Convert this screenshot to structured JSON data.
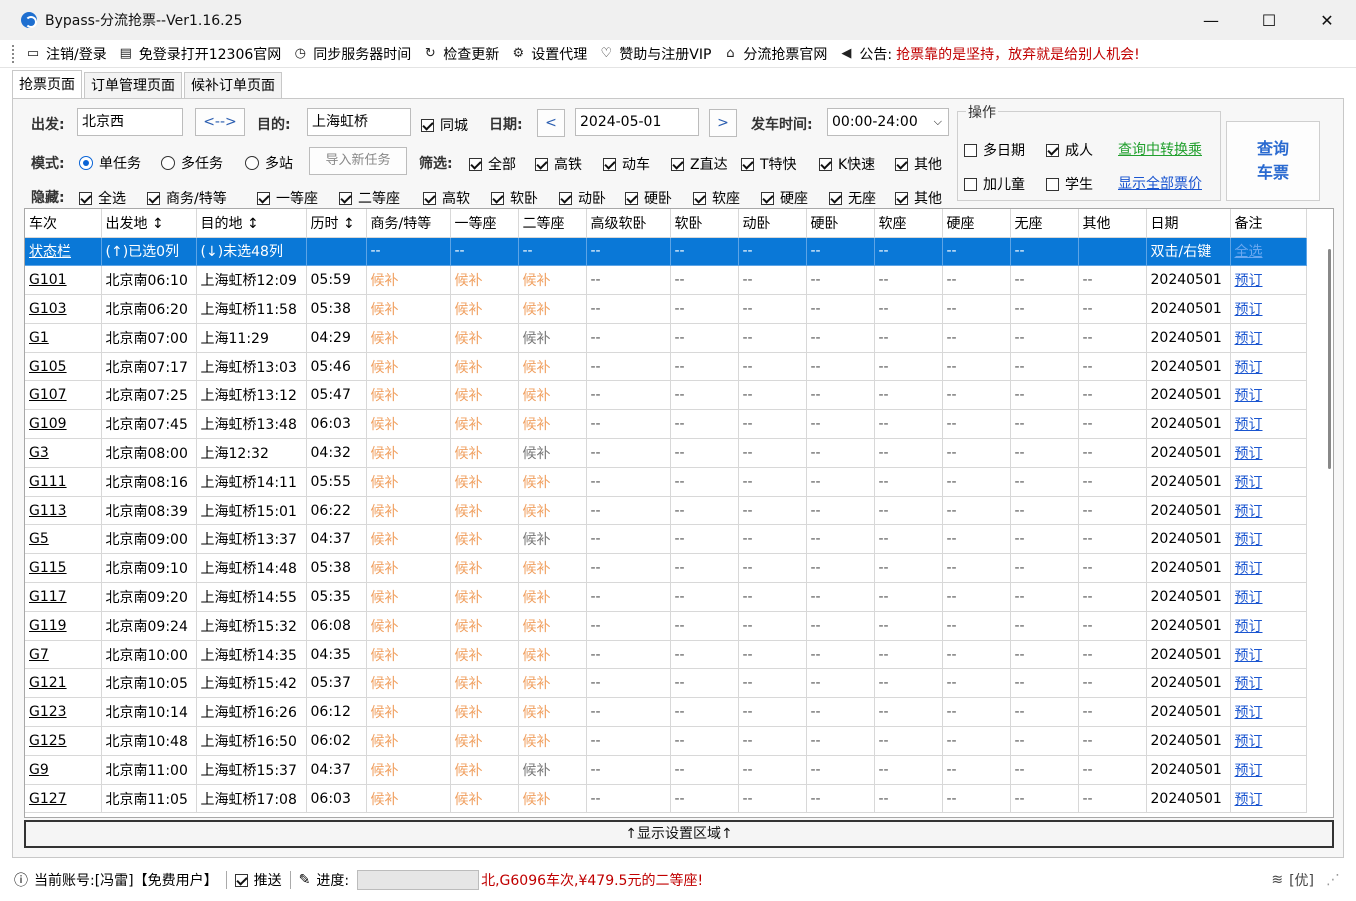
{
  "window": {
    "title": "Bypass-分流抢票--Ver1.16.25",
    "min": "—",
    "max": "☐",
    "close": "✕"
  },
  "menu": [
    {
      "icon": "▭",
      "label": "注销/登录"
    },
    {
      "icon": "▤",
      "label": "免登录打开12306官网"
    },
    {
      "icon": "◷",
      "label": "同步服务器时间"
    },
    {
      "icon": "↻",
      "label": "检查更新"
    },
    {
      "icon": "⚙",
      "label": "设置代理"
    },
    {
      "icon": "♡",
      "label": "赞助与注册VIP"
    },
    {
      "icon": "⌂",
      "label": "分流抢票官网"
    },
    {
      "icon": "◀",
      "label": "公告:"
    }
  ],
  "announcement": "抢票靠的是坚持，放弃就是给别人机会!",
  "tabs": [
    "抢票页面",
    "订单管理页面",
    "候补订单页面"
  ],
  "form": {
    "from_label": "出发:",
    "from_value": "北京西",
    "swap": "<-->",
    "to_label": "目的:",
    "to_value": "上海虹桥",
    "same_city": "同城",
    "date_label": "日期:",
    "prev": "<",
    "date_value": "2024-05-01",
    "next": ">",
    "time_label": "发车时间:",
    "time_value": "00:00-24:00",
    "mode_label": "模式:",
    "mode_single": "单任务",
    "mode_multi": "多任务",
    "mode_multi_station": "多站",
    "import_task": "导入新任务",
    "filter_label": "筛选:",
    "filters": [
      "全部",
      "高铁",
      "动车",
      "Z直达",
      "T特快",
      "K快速",
      "其他"
    ],
    "hide_label": "隐藏:",
    "hides": [
      "全选",
      "商务/特等",
      "一等座",
      "二等座",
      "高软",
      "软卧",
      "动卧",
      "硬卧",
      "软座",
      "硬座",
      "无座",
      "其他"
    ]
  },
  "ops": {
    "legend": "操作",
    "multi_date": "多日期",
    "adult": "成人",
    "query_transfer": "查询中转换乘",
    "child": "加儿童",
    "student": "学生",
    "show_all_price": "显示全部票价",
    "query_line1": "查询",
    "query_line2": "车票"
  },
  "table": {
    "headers": [
      "车次",
      "出发地 ↕",
      "目的地 ↕",
      "历时 ↕",
      "商务/特等",
      "一等座",
      "二等座",
      "高级软卧",
      "软卧",
      "动卧",
      "硬卧",
      "软座",
      "硬座",
      "无座",
      "其他",
      "日期",
      "备注"
    ],
    "status_row": [
      "状态栏",
      "(↑)已选0列",
      "(↓)未选48列",
      "",
      "--",
      "--",
      "--",
      "--",
      "--",
      "--",
      "--",
      "--",
      "--",
      "--",
      "",
      "双击/右键",
      "全选"
    ],
    "hb": "候补",
    "dash": "--",
    "book": "预订",
    "rows": [
      [
        "G101",
        "北京南06:10",
        "上海虹桥12:09",
        "05:59",
        "20240501",
        "o"
      ],
      [
        "G103",
        "北京南06:20",
        "上海虹桥11:58",
        "05:38",
        "20240501",
        "o"
      ],
      [
        "G1",
        "北京南07:00",
        "上海11:29",
        "04:29",
        "20240501",
        "g"
      ],
      [
        "G105",
        "北京南07:17",
        "上海虹桥13:03",
        "05:46",
        "20240501",
        "o"
      ],
      [
        "G107",
        "北京南07:25",
        "上海虹桥13:12",
        "05:47",
        "20240501",
        "o"
      ],
      [
        "G109",
        "北京南07:45",
        "上海虹桥13:48",
        "06:03",
        "20240501",
        "o"
      ],
      [
        "G3",
        "北京南08:00",
        "上海12:32",
        "04:32",
        "20240501",
        "g"
      ],
      [
        "G111",
        "北京南08:16",
        "上海虹桥14:11",
        "05:55",
        "20240501",
        "o"
      ],
      [
        "G113",
        "北京南08:39",
        "上海虹桥15:01",
        "06:22",
        "20240501",
        "o"
      ],
      [
        "G5",
        "北京南09:00",
        "上海虹桥13:37",
        "04:37",
        "20240501",
        "g"
      ],
      [
        "G115",
        "北京南09:10",
        "上海虹桥14:48",
        "05:38",
        "20240501",
        "o"
      ],
      [
        "G117",
        "北京南09:20",
        "上海虹桥14:55",
        "05:35",
        "20240501",
        "o"
      ],
      [
        "G119",
        "北京南09:24",
        "上海虹桥15:32",
        "06:08",
        "20240501",
        "o"
      ],
      [
        "G7",
        "北京南10:00",
        "上海虹桥14:35",
        "04:35",
        "20240501",
        "o"
      ],
      [
        "G121",
        "北京南10:05",
        "上海虹桥15:42",
        "05:37",
        "20240501",
        "o"
      ],
      [
        "G123",
        "北京南10:14",
        "上海虹桥16:26",
        "06:12",
        "20240501",
        "o"
      ],
      [
        "G125",
        "北京南10:48",
        "上海虹桥16:50",
        "06:02",
        "20240501",
        "o"
      ],
      [
        "G9",
        "北京南11:00",
        "上海虹桥15:37",
        "04:37",
        "20240501",
        "g"
      ],
      [
        "G127",
        "北京南11:05",
        "上海虹桥17:08",
        "06:03",
        "20240501",
        "o"
      ]
    ]
  },
  "settings_toggle": "↑显示设置区域↑",
  "status": {
    "account": "当前账号:[冯雷]【免费用户】",
    "push": "推送",
    "progress_label": "进度:",
    "message": "北,G6096车次,¥479.5元的二等座!",
    "vip": "[优]"
  },
  "colors": {
    "accent": "#0a78d7",
    "hb_orange": "#f0a060",
    "warn_red": "#c00000",
    "link_green": "#22a02e"
  }
}
